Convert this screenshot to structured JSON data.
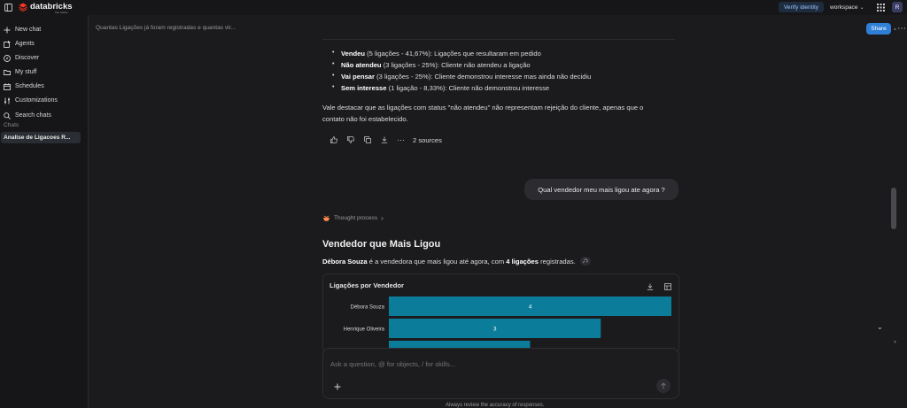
{
  "topbar": {
    "brand": "databricks",
    "brand_sub": "free edition",
    "verify_label": "Verify identity",
    "workspace_label": "workspace",
    "avatar_initial": "R"
  },
  "sidebar": {
    "items": [
      {
        "label": "New chat",
        "icon": "plus-icon"
      },
      {
        "label": "Agents",
        "icon": "agent-icon"
      },
      {
        "label": "Discover",
        "icon": "compass-icon"
      },
      {
        "label": "My stuff",
        "icon": "folder-icon"
      },
      {
        "label": "Schedules",
        "icon": "calendar-icon"
      },
      {
        "label": "Customizations",
        "icon": "sliders-icon"
      },
      {
        "label": "Search chats",
        "icon": "search-icon"
      }
    ],
    "section_label": "Chats",
    "active_chat": "Analise de Ligacoes R..."
  },
  "main": {
    "breadcrumb": "Quantas Ligações já foram registradas e quantas vir...",
    "share_label": "Share",
    "bullets": [
      {
        "bold": "Vendeu",
        "rest": " (5 ligações - 41,67%): Ligações que resultaram em pedido"
      },
      {
        "bold": "Não atendeu",
        "rest": " (3 ligações - 25%): Cliente não atendeu a ligação"
      },
      {
        "bold": "Vai pensar",
        "rest": " (3 ligações - 25%): Cliente demonstrou interesse mas ainda não decidiu"
      },
      {
        "bold": "Sem interesse",
        "rest": " (1 ligação - 8,33%): Cliente não demonstrou interesse"
      }
    ],
    "note_line1": "Vale destacar que as ligações com status \"não atendeu\" não representam rejeição do cliente, apenas que o",
    "note_line2": "contato não foi estabelecido.",
    "sources_label": "2 sources",
    "user_question": "Qual vendedor meu mais ligou ate agora ?",
    "thought_label": "Thought process",
    "answer_title": "Vendedor que Mais Ligou",
    "answer_bold1": "Débora Souza",
    "answer_mid": " é a vendedora que mais ligou até agora, com ",
    "answer_bold2": "4 ligações",
    "answer_end": " registradas.",
    "composer_placeholder": "Ask a question, @ for objects, / for skills...",
    "disclaimer": "Always review the accuracy of responses."
  },
  "colors": {
    "bar": "#0b7c9a",
    "accent": "#2e8ce6",
    "bg": "#1b1b1d"
  },
  "chart_data": {
    "type": "bar",
    "title": "Ligações por Vendedor",
    "orientation": "horizontal",
    "categories": [
      "Débora Souza",
      "Henrique Oliveira"
    ],
    "values": [
      4,
      3
    ],
    "partial_third_bar_value": 2,
    "xlim": [
      0,
      4
    ]
  }
}
